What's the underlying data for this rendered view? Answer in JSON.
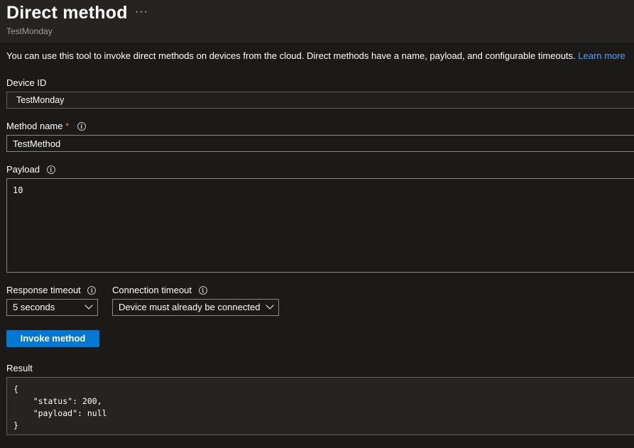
{
  "header": {
    "title": "Direct method",
    "more_label": "···",
    "subtitle": "TestMonday"
  },
  "description": {
    "text": "You can use this tool to invoke direct methods on devices from the cloud. Direct methods have a name, payload, and configurable timeouts. ",
    "link": "Learn more"
  },
  "device_id": {
    "label": "Device ID",
    "value": "TestMonday"
  },
  "method_name": {
    "label": "Method name",
    "required_mark": "*",
    "value": "TestMethod"
  },
  "payload": {
    "label": "Payload",
    "value": "10"
  },
  "response_timeout": {
    "label": "Response timeout",
    "selected": "5 seconds"
  },
  "connection_timeout": {
    "label": "Connection timeout",
    "selected": "Device must already be connected"
  },
  "invoke_button": {
    "label": "Invoke method"
  },
  "result": {
    "label": "Result",
    "lines": [
      "{",
      "    \"status\": 200,",
      "    \"payload\": null",
      "}"
    ]
  },
  "icons": {
    "info": "info-icon",
    "more": "more-icon",
    "dropdown": "chevron-down-icon"
  },
  "colors": {
    "background": "#1b1a19",
    "header_background": "#252423",
    "accent": "#0078d4",
    "link": "#4da3ff",
    "required": "#f1707b"
  }
}
